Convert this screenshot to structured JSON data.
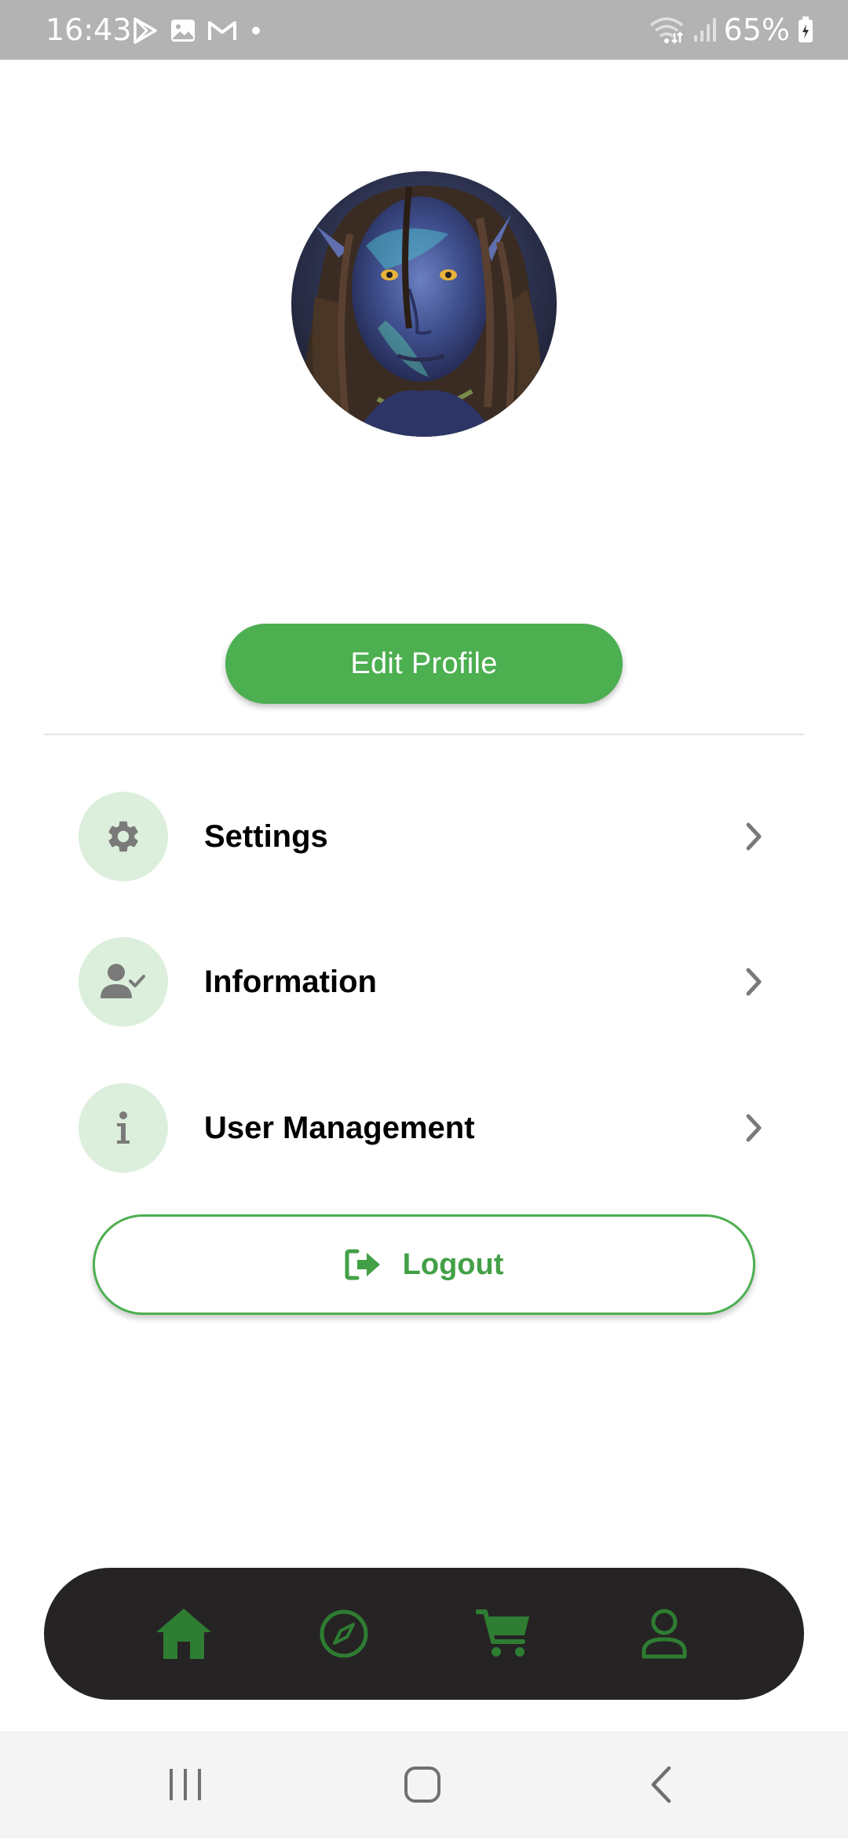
{
  "status_bar": {
    "time": "16:43",
    "battery": "65%",
    "icons": [
      "play-store-icon",
      "gallery-icon",
      "gmail-icon",
      "dot-icon",
      "wifi-icon",
      "signal-icon",
      "battery-icon"
    ]
  },
  "profile": {
    "avatar_alt": "avatar"
  },
  "edit_profile": {
    "label": "Edit Profile"
  },
  "menu": {
    "items": [
      {
        "label": "Settings",
        "icon": "gear-icon"
      },
      {
        "label": "Information",
        "icon": "user-check-icon"
      },
      {
        "label": "User Management",
        "icon": "info-icon"
      }
    ]
  },
  "logout": {
    "label": "Logout",
    "icon": "logout-icon"
  },
  "bottom_nav": {
    "items": [
      "home-icon",
      "compass-icon",
      "cart-icon",
      "user-icon"
    ]
  },
  "colors": {
    "accent": "#4caf50",
    "accent_dark": "#2e7d32",
    "icon_circle_bg": "#dcefdc",
    "nav_bg": "#262324",
    "status_bar_bg": "#b3b3b3"
  }
}
